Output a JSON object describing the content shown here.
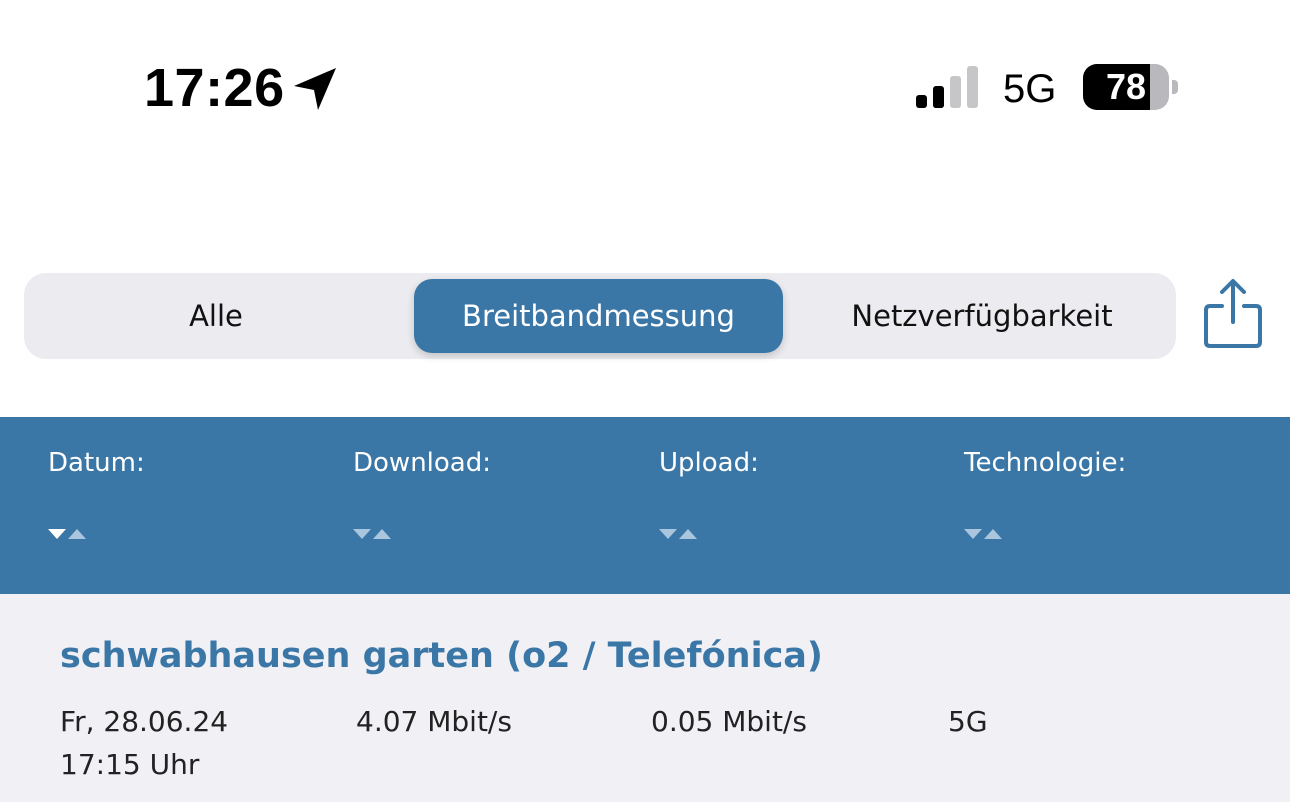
{
  "status_bar": {
    "time": "17:26",
    "location_icon": "location-arrow-icon",
    "signal_icon": "cellular-signal-icon",
    "signal_bars_active": 2,
    "signal_bars_total": 4,
    "network": "5G",
    "battery_percent": 78
  },
  "segmented_control": {
    "segments": [
      {
        "label": "Alle",
        "selected": false
      },
      {
        "label": "Breitbandmessung",
        "selected": true
      },
      {
        "label": "Netzverfügbarkeit",
        "selected": false
      }
    ]
  },
  "share_button": {
    "icon": "share-icon"
  },
  "table": {
    "columns": [
      {
        "label": "Datum:",
        "sort": "descending"
      },
      {
        "label": "Download:",
        "sort": "none"
      },
      {
        "label": "Upload:",
        "sort": "none"
      },
      {
        "label": "Technologie:",
        "sort": "none"
      }
    ],
    "rows": [
      {
        "title": "schwabhausen garten (o2 / Telefónica)",
        "date": "Fr, 28.06.24",
        "time": "17:15 Uhr",
        "download": "4.07 Mbit/s",
        "upload": "0.05 Mbit/s",
        "technology": "5G"
      }
    ]
  },
  "colors": {
    "accent": "#3b77a6",
    "segment_background": "#ececf0",
    "row_background": "#f0f0f5"
  }
}
